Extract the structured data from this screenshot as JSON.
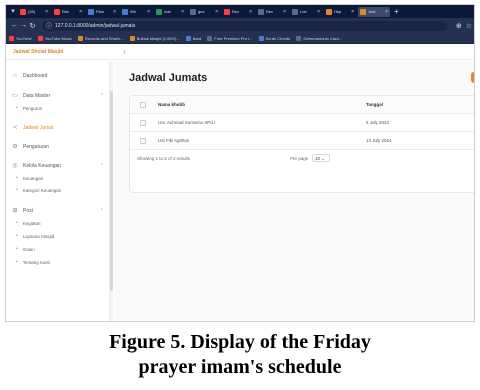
{
  "browser": {
    "tabs": [
      {
        "title": "(28) ",
        "color": "#ff3d3d",
        "active": false
      },
      {
        "title": "Rec",
        "color": "#ff3d3d",
        "active": false
      },
      {
        "title": "Plan",
        "color": "#4a7bd6",
        "active": false
      },
      {
        "title": "Wh",
        "color": "#4a7bd6",
        "active": false
      },
      {
        "title": "Adv",
        "color": "#1f9d55",
        "active": false
      },
      {
        "title": "ges",
        "color": "#5a6b8a",
        "active": false
      },
      {
        "title": "Rec",
        "color": "#ff3d3d",
        "active": false
      },
      {
        "title": "Rec",
        "color": "#5a6b8a",
        "active": false
      },
      {
        "title": "Lob",
        "color": "#5a6b8a",
        "active": false
      },
      {
        "title": "Hkp",
        "color": "#e0892a",
        "active": false
      },
      {
        "title": "Jadi",
        "color": "#e0892a",
        "active": true
      }
    ],
    "url": "127.0.0.1:8000/admin/jadwal-jumats",
    "bookmarks": [
      {
        "label": "YouTube",
        "color": "#ff3d3d"
      },
      {
        "label": "YouTube Music",
        "color": "#ff3d3d"
      },
      {
        "label": "Records and Sharin...",
        "color": "#e0892a"
      },
      {
        "label": "Buklak Masjid (1.0KG)...",
        "color": "#e0892a"
      },
      {
        "label": "Bard",
        "color": "#4a7bd6"
      },
      {
        "label": "Free Premium Pro I...",
        "color": "#5a6b8a"
      },
      {
        "label": "Surah Chords",
        "color": "#4a7bd6"
      },
      {
        "label": "Schemantonio Card...",
        "color": "#5a6b8a"
      }
    ]
  },
  "app": {
    "logo": "Jadwal Sholat Masjid",
    "sidebar": {
      "items": [
        {
          "label": "Dashboard",
          "icon": "home-icon",
          "glyph": "⌂",
          "active": false,
          "chevron": false
        },
        {
          "label": "Data Master",
          "icon": "folder-icon",
          "glyph": "▭",
          "active": false,
          "chevron": true
        },
        {
          "label": "Pengurus",
          "sub": true
        },
        {
          "label": "Jadwal Jumat",
          "icon": "share-icon",
          "glyph": "≺",
          "active": true,
          "chevron": false
        },
        {
          "label": "Pengaturan",
          "icon": "gear-icon",
          "glyph": "⚙",
          "active": false,
          "chevron": false
        },
        {
          "label": "Kelola Keuangan",
          "icon": "money-icon",
          "glyph": "◎",
          "active": false,
          "chevron": true
        },
        {
          "label": "Keuangan",
          "sub": true
        },
        {
          "label": "Kategori Keuangan",
          "sub": true
        },
        {
          "label": "Post",
          "icon": "grid-icon",
          "glyph": "⊞",
          "active": false,
          "chevron": true
        },
        {
          "label": "Kegiatan",
          "sub": true
        },
        {
          "label": "Layanan Masjid",
          "sub": true
        },
        {
          "label": "Galeri",
          "sub": true
        },
        {
          "label": "Tentang Kami",
          "sub": true
        }
      ]
    },
    "page_title": "Jadwal Jumats",
    "table": {
      "columns": [
        "Nama khotib",
        "Tanggal"
      ],
      "rows": [
        {
          "name": "Ust. Achmad Sumarno SPd.I",
          "date": "5 July 2024"
        },
        {
          "name": "Ust Fiki Agithan",
          "date": "13 July 2024"
        }
      ],
      "showing": "Showing 1 to 2 of 2 results",
      "per_page_label": "Per page",
      "per_page_value": "10"
    }
  },
  "caption": {
    "line1": "Figure 5. Display of the Friday",
    "line2": "prayer imam's schedule"
  }
}
